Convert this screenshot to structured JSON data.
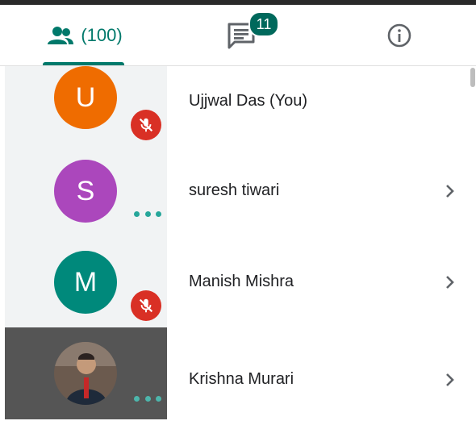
{
  "tabs": {
    "people_count": "(100)",
    "chat_badge": "11"
  },
  "participants": [
    {
      "initial": "U",
      "name": "Ujjwal Das (You)",
      "avatar_color": "#ef6c00",
      "status": "muted"
    },
    {
      "initial": "S",
      "name": "suresh tiwari",
      "avatar_color": "#ab47bc",
      "status": "more"
    },
    {
      "initial": "M",
      "name": "Manish Mishra",
      "avatar_color": "#00897b",
      "status": "muted"
    },
    {
      "initial": "",
      "name": "Krishna Murari",
      "avatar_color": "#7a5a48",
      "status": "more"
    }
  ],
  "colors": {
    "accent": "#00796b",
    "mute_red": "#d93025",
    "dots_teal": "#26a69a"
  }
}
